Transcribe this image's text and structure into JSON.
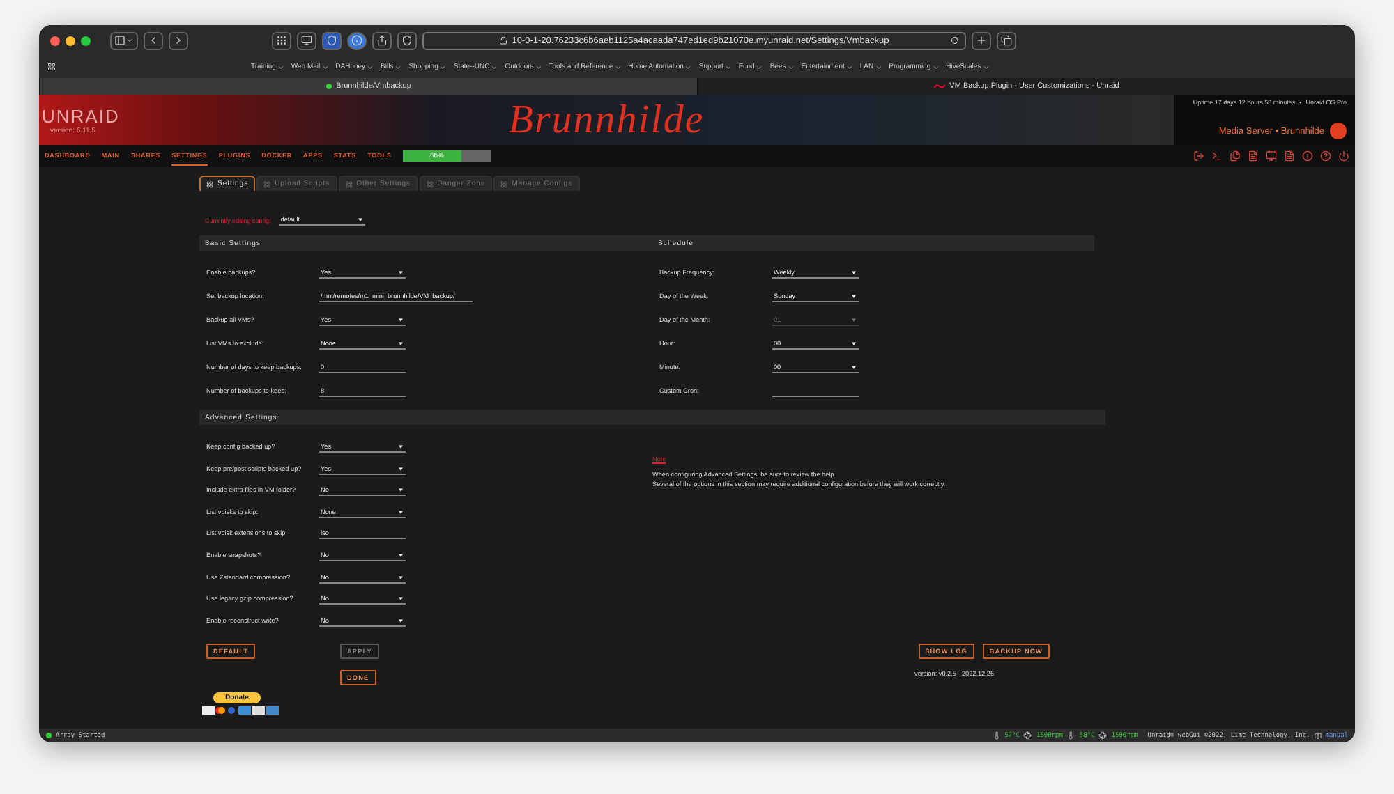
{
  "browser": {
    "url": "10-0-1-20.76233c6b6aeb1125a4acaada747ed1ed9b21070e.myunraid.net/Settings/Vmbackup",
    "bookmarks": [
      "Training",
      "Web Mail",
      "DAHoney",
      "Bills",
      "Shopping",
      "State--UNC",
      "Outdoors",
      "Tools and Reference",
      "Home Automation",
      "Support",
      "Food",
      "Bees",
      "Entertainment",
      "LAN",
      "Programming",
      "HiveScales"
    ],
    "tabs": [
      {
        "title": "Brunnhilde/Vmbackup",
        "selected": true
      },
      {
        "title": "VM Backup Plugin - User Customizations - Unraid",
        "selected": false
      }
    ]
  },
  "header": {
    "brand": "UNRAID",
    "version": "version: 6.11.5",
    "title": "Brunnhilde",
    "uptime": "Uptime 17 days 12 hours 58 minutes",
    "separator": "•",
    "edition": "Unraid OS Pro",
    "server": "Media Server • Brunnhilde"
  },
  "nav": {
    "items": [
      {
        "label": "DASHBOARD",
        "selected": false
      },
      {
        "label": "MAIN",
        "selected": false
      },
      {
        "label": "SHARES",
        "selected": false
      },
      {
        "label": "SETTINGS",
        "selected": true
      },
      {
        "label": "PLUGINS",
        "selected": false
      },
      {
        "label": "DOCKER",
        "selected": false
      },
      {
        "label": "APPS",
        "selected": false
      },
      {
        "label": "STATS",
        "selected": false
      },
      {
        "label": "TOOLS",
        "selected": false
      }
    ],
    "usage": {
      "level": 0.66,
      "label": "66%"
    }
  },
  "page_tabs": [
    {
      "label": "Settings",
      "selected": true
    },
    {
      "label": "Upload Scripts",
      "selected": false
    },
    {
      "label": "Other Settings",
      "selected": false
    },
    {
      "label": "Danger Zone",
      "selected": false
    },
    {
      "label": "Manage Configs",
      "selected": false
    }
  ],
  "config": {
    "label": "Currently editing config:",
    "value": "default"
  },
  "basic_settings": {
    "title": "Basic Settings",
    "fields": [
      {
        "label": "Enable backups?",
        "kind": "select",
        "value": "Yes"
      },
      {
        "label": "Set backup location:",
        "kind": "wide",
        "value": "/mnt/remotes/m1_mini_brunnhilde/VM_backup/"
      },
      {
        "label": "Backup all VMs?",
        "kind": "select",
        "value": "Yes"
      },
      {
        "label": "List VMs to exclude:",
        "kind": "select",
        "value": "None"
      },
      {
        "label": "Number of days to keep backups:",
        "kind": "text",
        "value": "0"
      },
      {
        "label": "Number of backups to keep:",
        "kind": "text",
        "value": "8"
      }
    ]
  },
  "schedule": {
    "title": "Schedule",
    "fields": [
      {
        "label": "Backup Frequency:",
        "kind": "select",
        "value": "Weekly",
        "disabled": false
      },
      {
        "label": "Day of the Week:",
        "kind": "select",
        "value": "Sunday",
        "disabled": false
      },
      {
        "label": "Day of the Month:",
        "kind": "select",
        "value": "01",
        "disabled": true
      },
      {
        "label": "Hour:",
        "kind": "select",
        "value": "00",
        "disabled": false
      },
      {
        "label": "Minute:",
        "kind": "select",
        "value": "00",
        "disabled": false
      },
      {
        "label": "Custom Cron:",
        "kind": "text",
        "disabled": false
      }
    ]
  },
  "advanced_settings": {
    "title": "Advanced Settings",
    "fields": [
      {
        "label": "Keep config backed up?",
        "kind": "select",
        "value": "Yes"
      },
      {
        "label": "Keep pre/post scripts backed up?",
        "kind": "select",
        "value": "Yes"
      },
      {
        "label": "Include extra files in VM folder?",
        "kind": "select",
        "value": "No"
      },
      {
        "label": "List vdisks to skip:",
        "kind": "select",
        "value": "None"
      },
      {
        "label": "List vdisk extensions to skip:",
        "kind": "text",
        "value": "iso"
      },
      {
        "label": "Enable snapshots?",
        "kind": "select",
        "value": "No"
      },
      {
        "label": "Use Zstandard compression?",
        "kind": "select",
        "value": "No"
      },
      {
        "label": "Use legacy gzip compression?",
        "kind": "select",
        "value": "No"
      },
      {
        "label": "Enable reconstruct write?",
        "kind": "select",
        "value": "No"
      }
    ],
    "note": {
      "link": "Note",
      "lines": [
        "When configuring Advanced Settings, be sure to review the help.",
        "Several of the options in this section may require additional configuration before they will work correctly."
      ]
    }
  },
  "buttons": {
    "default": {
      "label": "DEFAULT",
      "disabled": false
    },
    "apply": {
      "label": "APPLY",
      "disabled": true
    },
    "done": {
      "label": "DONE",
      "disabled": false
    },
    "show_log": {
      "label": "SHOW LOG",
      "disabled": false
    },
    "backup_now": {
      "label": "BACKUP NOW",
      "disabled": false
    }
  },
  "version": "version: v0.2.5 - 2022.12.25",
  "donate": "Donate",
  "status_bar": {
    "array": "Array Started",
    "temp_1": "57°C",
    "fan_1": "1500rpm",
    "temp_2": "58°C",
    "fan_2": "1500rpm",
    "copyright": "Unraid® webGui ©2022, Lime Technology, Inc.",
    "manual": "manual"
  }
}
